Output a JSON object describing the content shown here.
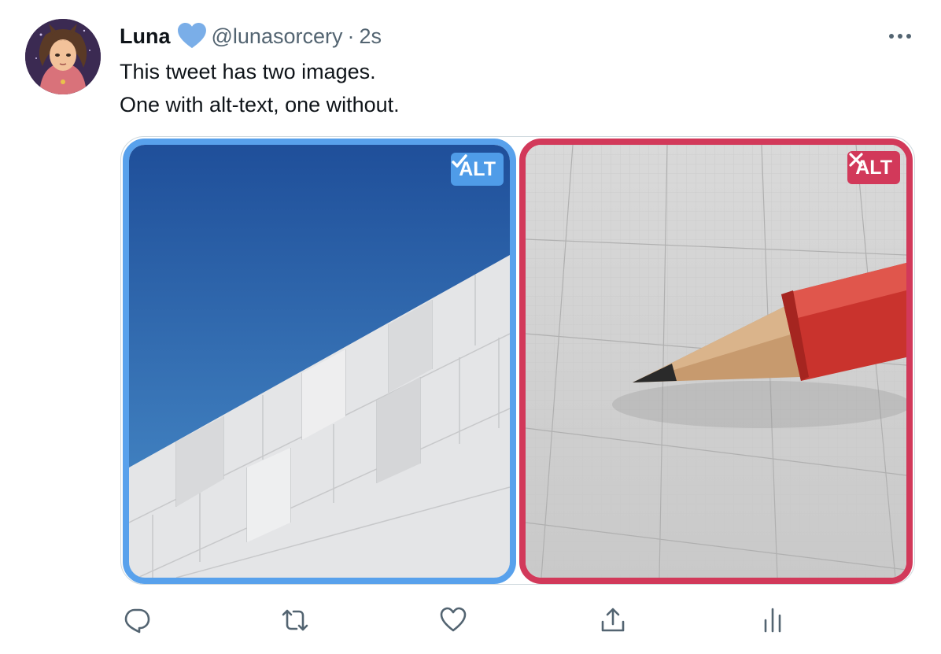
{
  "tweet": {
    "author_name": "Luna",
    "handle": "@lunasorcery",
    "separator": "·",
    "time": "2s",
    "text_lines": [
      "This tweet has two images.",
      "One with alt-text, one without."
    ]
  },
  "media": [
    {
      "description": "photo of white tiled building facade against blue sky",
      "badge": "ALT",
      "badge_icon": "check-icon",
      "has_alt": true
    },
    {
      "description": "photo of red pencil on graph paper",
      "badge": "ALT",
      "badge_icon": "x-icon",
      "has_alt": false
    }
  ],
  "actions": [
    {
      "icon": "reply-icon"
    },
    {
      "icon": "retweet-icon"
    },
    {
      "icon": "like-icon"
    },
    {
      "icon": "share-icon"
    },
    {
      "icon": "analytics-icon"
    }
  ],
  "colors": {
    "verified": "#7aaee8",
    "alt_present": "#4f9ce8",
    "alt_missing": "#d2395a",
    "secondary_text": "#536471",
    "icon": "#536471"
  }
}
